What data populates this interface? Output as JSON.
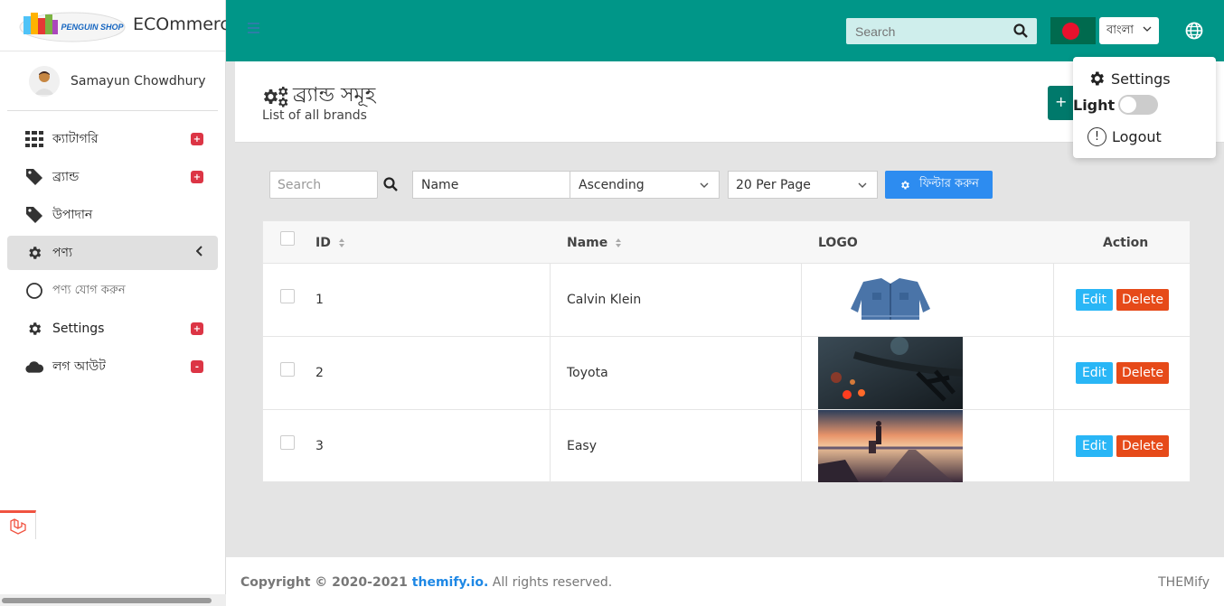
{
  "sidebar": {
    "logo_text": "PENGUIN SHOP",
    "brand": "ECOmmerce",
    "user_name": "Samayun Chowdhury",
    "items": [
      {
        "label": "ক্যাটাগরি",
        "badge": "+"
      },
      {
        "label": "ব্র্যান্ড",
        "badge": "+"
      },
      {
        "label": "উপাদান",
        "badge": ""
      },
      {
        "label": "পণ্য",
        "badge": ""
      },
      {
        "label": "পণ্য যোগ করুন",
        "badge": ""
      },
      {
        "label": "Settings",
        "badge": "+"
      },
      {
        "label": "লগ আউট",
        "badge": "-"
      }
    ]
  },
  "topbar": {
    "search_placeholder": "Search",
    "language": "বাংলা"
  },
  "dropdown": {
    "settings": "Settings",
    "light": "Light",
    "logout": "Logout"
  },
  "header": {
    "title": "ব্র্যান্ড সমূহ",
    "subtitle": "List of all brands",
    "add_label": "+"
  },
  "filters": {
    "search_placeholder": "Search",
    "sort_field": "Name",
    "sort_order": "Ascending",
    "per_page": "20 Per Page",
    "filter_button": "ফিল্টার করুন"
  },
  "table": {
    "columns": [
      "ID",
      "Name",
      "LOGO",
      "Action"
    ],
    "rows": [
      {
        "id": "1",
        "name": "Calvin Klein"
      },
      {
        "id": "2",
        "name": "Toyota"
      },
      {
        "id": "3",
        "name": "Easy"
      }
    ],
    "edit_label": "Edit",
    "delete_label": "Delete"
  },
  "footer": {
    "copyright": "Copyright © 2020-2021 ",
    "link": "themify.io.",
    "rights": " All rights reserved.",
    "right_text": "THEMify"
  },
  "colors": {
    "topbar": "#009688",
    "primary_button": "#2d8cf0",
    "edit": "#29b6f6",
    "delete": "#e64a19",
    "badge": "#dc3545"
  }
}
